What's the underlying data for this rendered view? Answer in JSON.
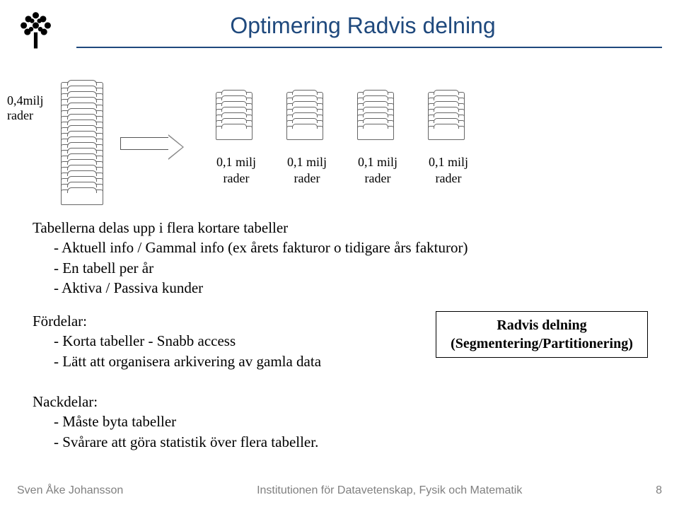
{
  "title": "Optimering Radvis delning",
  "big_stack": {
    "label_line1": "0,4milj",
    "label_line2": "rader"
  },
  "small_stacks": [
    {
      "label_line1": "0,1 milj",
      "label_line2": "rader"
    },
    {
      "label_line1": "0,1 milj",
      "label_line2": "rader"
    },
    {
      "label_line1": "0,1 milj",
      "label_line2": "rader"
    },
    {
      "label_line1": "0,1 milj",
      "label_line2": "rader"
    }
  ],
  "para1": {
    "line1": "Tabellerna delas upp i flera kortare tabeller",
    "b1": "- Aktuell  info / Gammal info  (ex årets fakturor o tidigare års fakturor)",
    "b2": "- En tabell per år",
    "b3": "- Aktiva / Passiva kunder"
  },
  "para2": {
    "head": "Fördelar:",
    "b1": "- Korta tabeller - Snabb access",
    "b2": "- Lätt att organisera arkivering av gamla data"
  },
  "para3": {
    "head": "Nackdelar:",
    "b1": "- Måste byta tabeller",
    "b2": "- Svårare att göra statistik över flera tabeller."
  },
  "callout": {
    "line1": "Radvis delning",
    "line2": "(Segmentering/Partitionering)"
  },
  "footer": {
    "author": "Sven Åke Johansson",
    "inst": "Institutionen för Datavetenskap, Fysik och Matematik",
    "page": "8"
  }
}
